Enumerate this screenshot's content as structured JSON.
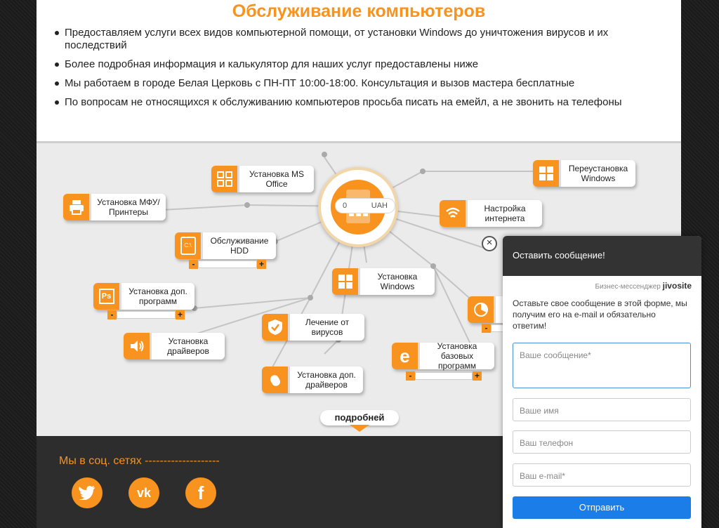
{
  "header": {
    "title": "Обслуживание компьютеров",
    "bullets": [
      "Предоставляем услуги всех видов компьютерной помощи, от установки Windows до уничтожения вирусов и их последствий",
      "Более подробная информация и калькулятор для наших услуг предоставлены ниже",
      "Мы работаем в городе Белая Церковь с ПН-ПТ 10:00-18:00. Консультация и вызов мастера бесплатные",
      "По вопросам не относящихся к обслуживанию компьютеров просьба писать на емейл, а не звонить на телефоны"
    ]
  },
  "calculator": {
    "value": "0",
    "currency": "UAH"
  },
  "services": {
    "ms_office": "Установка MS Office",
    "printers": "Установка МФУ/Принтеры",
    "hdd": "Обслуживание HDD",
    "extra_programs": "Установка доп. программ",
    "drivers": "Установка драйверов",
    "antivirus": "Лечение от вирусов",
    "extra_drivers": "Установка доп. драйверов",
    "windows": "Установка Windows",
    "basic_programs": "Установка базовых программ",
    "reinstall_windows": "Переустановка Windows",
    "internet": "Настройка интернета",
    "hdd_icon_text": "C:\\"
  },
  "more_button": "подробней",
  "stepper": {
    "minus": "-",
    "plus": "+"
  },
  "footer": {
    "social_title": "Мы в соц. сетях --------------------",
    "vk": "vk",
    "facebook": "f"
  },
  "chat": {
    "header": "Оставить сообщение!",
    "brand_prefix": "Бизнес-мессенджер",
    "brand_name": "jivosite",
    "intro": "Оставьте свое сообщение в этой форме, мы получим его на e-mail и обязательно ответим!",
    "message_placeholder": "Ваше сообщение*",
    "name_placeholder": "Ваше имя",
    "phone_placeholder": "Ваш телефон",
    "email_placeholder": "Ваш e-mail*",
    "send_label": "Отправить",
    "close_label": "×"
  },
  "colors": {
    "accent": "#f7931e",
    "dark": "#2d2d2d",
    "send": "#1a7de8"
  }
}
